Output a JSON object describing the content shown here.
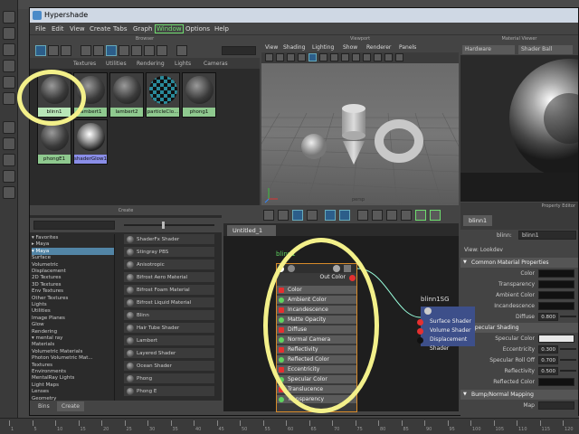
{
  "window": {
    "title": "Hypershade"
  },
  "menubar": [
    "File",
    "Edit",
    "View",
    "Create",
    "Tabs",
    "Graph",
    "Window",
    "Options",
    "Help"
  ],
  "browser": {
    "title": "Browser",
    "tabs": [
      "Textures",
      "Utilities",
      "Rendering",
      "Lights",
      "Cameras"
    ],
    "materials": [
      {
        "name": "blinn1",
        "style": "sel"
      },
      {
        "name": "lambert1",
        "style": "normal"
      },
      {
        "name": "lambert2",
        "style": "normal"
      },
      {
        "name": "particleClo...",
        "style": "check"
      },
      {
        "name": "phong1",
        "style": "normal"
      },
      {
        "name": "phongE1",
        "style": "normal"
      },
      {
        "name": "shaderGlow1",
        "style": "glow"
      }
    ]
  },
  "viewport": {
    "title": "Viewport",
    "menu": [
      "View",
      "Shading",
      "Lighting",
      "Show",
      "Renderer",
      "Panels"
    ],
    "camera_label": "persp"
  },
  "attribute_editor": {
    "title": "Material Viewer",
    "renderer": "Hardware",
    "preview_mode": "Shader Ball",
    "property_title": "Property Editor",
    "tab": "blinn1",
    "name_label": "blinn:",
    "name_value": "blinn1",
    "view_label": "View: Lookdev",
    "sections": {
      "common": "Common Material Properties",
      "specular": "Specular Shading",
      "bump": "Bump/Normal Mapping"
    },
    "common_rows": [
      {
        "label": "Color",
        "type": "color",
        "color": "#111111"
      },
      {
        "label": "Transparency",
        "type": "color",
        "color": "#111111"
      },
      {
        "label": "Ambient Color",
        "type": "color",
        "color": "#111111"
      },
      {
        "label": "Incandescence",
        "type": "color",
        "color": "#111111"
      },
      {
        "label": "Diffuse",
        "type": "value",
        "value": "0.800"
      }
    ],
    "specular_rows": [
      {
        "label": "Specular Color",
        "type": "color",
        "color": "#e8e8e8"
      },
      {
        "label": "Eccentricity",
        "type": "value",
        "value": "0.300"
      },
      {
        "label": "Specular Roll Off",
        "type": "value",
        "value": "0.700"
      },
      {
        "label": "Reflectivity",
        "type": "value",
        "value": "0.500"
      },
      {
        "label": "Reflected Color",
        "type": "color",
        "color": "#111111"
      }
    ],
    "bump_rows": [
      {
        "label": "Map",
        "type": "color",
        "color": "#2b2b2b"
      }
    ]
  },
  "create_panel": {
    "title": "Create",
    "tree": [
      {
        "label": "▾ Favorites",
        "sel": false
      },
      {
        "label": "   ▸ Maya",
        "sel": false
      },
      {
        "label": "▾ Maya",
        "sel": true
      },
      {
        "label": "   Surface",
        "sel": false
      },
      {
        "label": "   Volumetric",
        "sel": false
      },
      {
        "label": "   Displacement",
        "sel": false
      },
      {
        "label": "   2D Textures",
        "sel": false
      },
      {
        "label": "   3D Textures",
        "sel": false
      },
      {
        "label": "   Env Textures",
        "sel": false
      },
      {
        "label": "   Other Textures",
        "sel": false
      },
      {
        "label": "   Lights",
        "sel": false
      },
      {
        "label": "   Utilities",
        "sel": false
      },
      {
        "label": "   Image Planes",
        "sel": false
      },
      {
        "label": "   Glow",
        "sel": false
      },
      {
        "label": "   Rendering",
        "sel": false
      },
      {
        "label": "▾ mental ray",
        "sel": false
      },
      {
        "label": "   Materials",
        "sel": false
      },
      {
        "label": "   Volumetric Materials",
        "sel": false
      },
      {
        "label": "   Photon Volumetric Mat...",
        "sel": false
      },
      {
        "label": "   Textures",
        "sel": false
      },
      {
        "label": "   Environments",
        "sel": false
      },
      {
        "label": "   MentalRay Lights",
        "sel": false
      },
      {
        "label": "   Light Maps",
        "sel": false
      },
      {
        "label": "   Lenses",
        "sel": false
      },
      {
        "label": "   Geometry",
        "sel": false
      }
    ],
    "items": [
      "ShaderFx Shader",
      "Stingray PBS",
      "Anisotropic",
      "Bifrost Aero Material",
      "Bifrost Foam Material",
      "Bifrost Liquid Material",
      "Blinn",
      "Hair Tube Shader",
      "Lambert",
      "Layered Shader",
      "Ocean Shader",
      "Phong",
      "Phong E"
    ],
    "bottom_tabs": [
      "Bins",
      "Create"
    ]
  },
  "node_editor": {
    "tab": "Untitled_1",
    "node_title": "blinn1",
    "out_port": "Out Color",
    "attributes": [
      "Color",
      "Ambient Color",
      "Incandescence",
      "Matte Opacity",
      "Diffuse",
      "Normal Camera",
      "Reflectivity",
      "Reflected Color",
      "Eccentricity",
      "Specular Color",
      "Translucence",
      "Transparency"
    ],
    "sg_title": "blinn1SG",
    "sg_ports": [
      "Surface Shader",
      "Volume Shader",
      "Displacement Shader"
    ]
  },
  "timeline": {
    "ticks": [
      "1",
      "5",
      "10",
      "15",
      "20",
      "25",
      "30",
      "35",
      "40",
      "45",
      "50",
      "55",
      "60",
      "65",
      "70",
      "75",
      "80",
      "85",
      "90",
      "95",
      "100",
      "105",
      "110",
      "115",
      "120"
    ]
  },
  "colors": {
    "highlight_ring": "#f3f08a",
    "node_border": "#d88b2a",
    "menu_highlight": "#6fdc6f"
  }
}
